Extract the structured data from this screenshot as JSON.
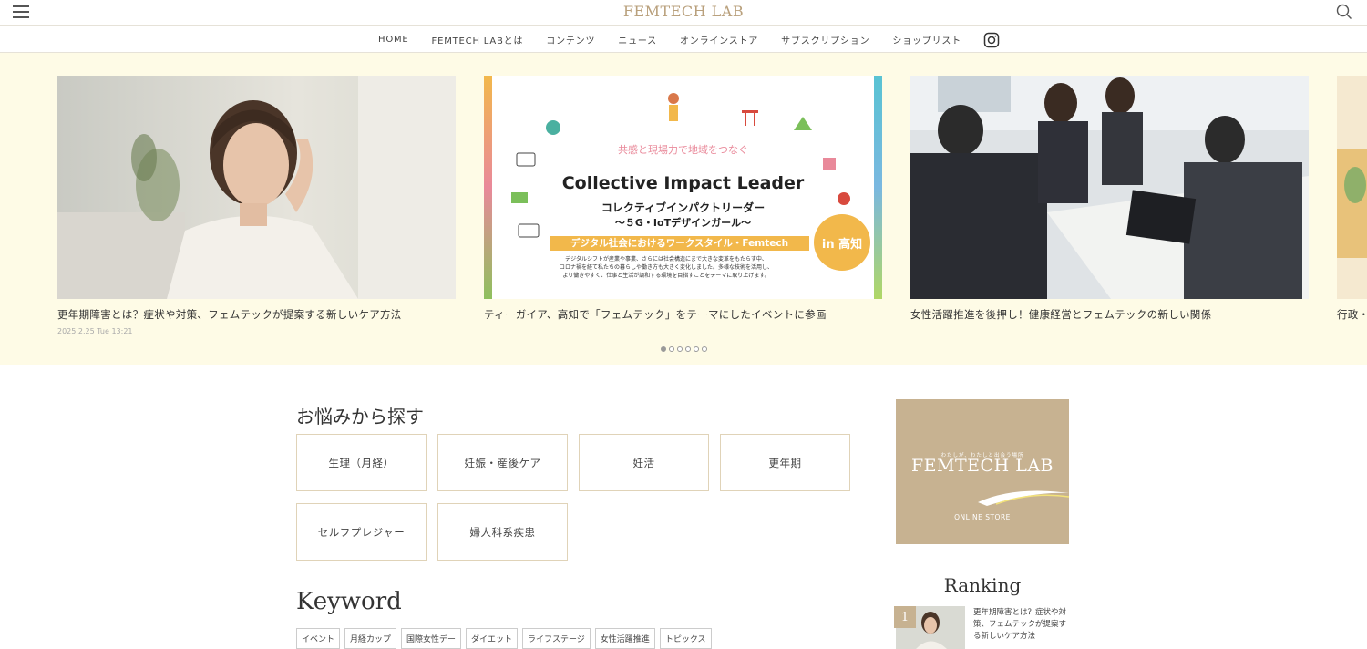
{
  "header": {
    "logo": "FEMTECH LAB",
    "menu_icon": "hamburger-menu-icon",
    "search_icon": "search-icon"
  },
  "nav": {
    "items": [
      "HOME",
      "FEMTECH LABとは",
      "コンテンツ",
      "ニュース",
      "オンラインストア",
      "サブスクリプション",
      "ショップリスト"
    ],
    "instagram_icon": "instagram-icon"
  },
  "slider": {
    "slides": [
      {
        "title": "更年期障害とは？症状や対策、フェムテックが提案する新しいケア方法",
        "date": "2025.2.25 Tue 13:21"
      },
      {
        "title": "ティーガイア、高知で「フェムテック」をテーマにしたイベントに参画",
        "banner": {
          "tagline": "共感と現場力で地域をつなぐ",
          "headline": "Collective Impact Leader",
          "katakana": "コレクティブインパクトリーダー",
          "subtitle": "～５G・IoTデザインガール～",
          "strip": "デジタル社会におけるワークスタイル・Femtech",
          "badge": "in 高知",
          "body": [
            "デジタルシフトが産業や事業、さらには社会構造にまで大きな変革をもたらす中、",
            "コロナ禍を経て私たちの暮らしや働き方も大きく変化しました。多様な技術を活用し、",
            "より働きやすく、仕事と生活が調和する環境を目指すことをテーマに取り上げます。"
          ]
        }
      },
      {
        "title": "女性活躍推進を後押し！健康経営とフェムテックの新しい関係"
      },
      {
        "title": "行政・企"
      }
    ],
    "dot_count": 6,
    "active_dot": 0
  },
  "concerns": {
    "title": "お悩みから探す",
    "items": [
      "生理（月経）",
      "妊娠・産後ケア",
      "妊活",
      "更年期",
      "セルフプレジャー",
      "婦人科系疾患"
    ]
  },
  "keywords": {
    "title": "Keyword",
    "tags": [
      "イベント",
      "月経カップ",
      "国際女性デー",
      "ダイエット",
      "ライフステージ",
      "女性活躍推進",
      "トピックス"
    ]
  },
  "store_banner": {
    "tagline": "わたしが、わたしと出会う場所",
    "logo": "FEMTECH LAB",
    "sub": "ONLINE STORE"
  },
  "ranking": {
    "title": "Ranking",
    "items": [
      {
        "rank": "1",
        "title": "更年期障害とは？症状や対策、フェムテックが提案する新しいケア方法"
      }
    ]
  },
  "colors": {
    "brand_gold": "#b9a07c",
    "slider_bg": "#fefbe6",
    "banner_tan": "#c7b291",
    "badge_orange": "#f2b84b"
  }
}
